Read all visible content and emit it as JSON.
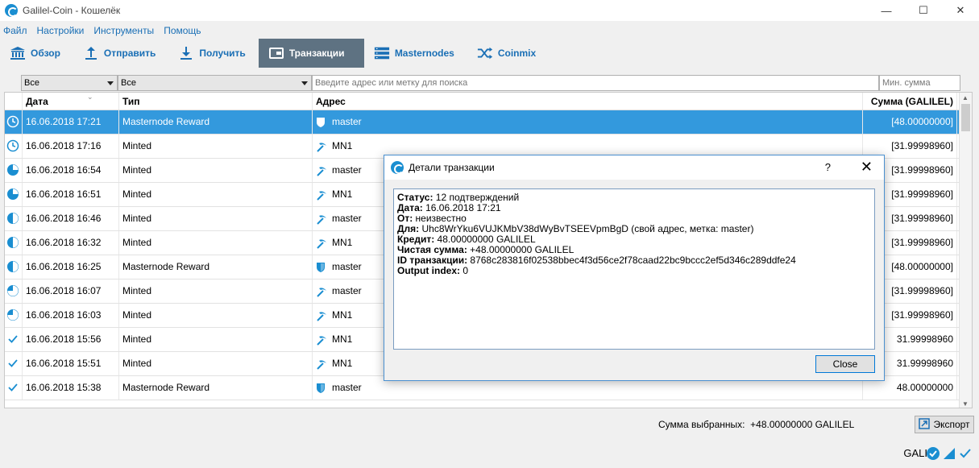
{
  "window": {
    "title": "Galilel-Coin - Кошелёк",
    "controls": [
      "—",
      "☐",
      "✕"
    ]
  },
  "menu": [
    "Файл",
    "Настройки",
    "Инструменты",
    "Помощь"
  ],
  "toolbar": [
    {
      "label": "Обзор",
      "icon": "bank-icon"
    },
    {
      "label": "Отправить",
      "icon": "upload-icon"
    },
    {
      "label": "Получить",
      "icon": "download-icon"
    },
    {
      "label": "Транзакции",
      "icon": "wallet-icon"
    },
    {
      "label": "Masternodes",
      "icon": "servers-icon"
    },
    {
      "label": "Coinmix",
      "icon": "shuffle-icon"
    }
  ],
  "filters": {
    "date": "Все",
    "type": "Все",
    "search_placeholder": "Введите адрес или метку для поиска",
    "min_amount_placeholder": "Мин. сумма"
  },
  "columns": [
    "Дата",
    "Тип",
    "Адрес",
    "Сумма (GALILEL)"
  ],
  "rows": [
    {
      "status": "clock",
      "date": "16.06.2018 17:21",
      "type": "Masternode Reward",
      "addr_icon": "shield",
      "address": "master",
      "amount": "[48.00000000]",
      "selected": true
    },
    {
      "status": "clock",
      "date": "16.06.2018 17:16",
      "type": "Minted",
      "addr_icon": "pickaxe",
      "address": "MN1",
      "amount": "[31.99998960]"
    },
    {
      "status": "pie-1",
      "date": "16.06.2018 16:54",
      "type": "Minted",
      "addr_icon": "pickaxe",
      "address": "master",
      "amount": "[31.99998960]"
    },
    {
      "status": "pie-1",
      "date": "16.06.2018 16:51",
      "type": "Minted",
      "addr_icon": "pickaxe",
      "address": "MN1",
      "amount": "[31.99998960]"
    },
    {
      "status": "pie-2",
      "date": "16.06.2018 16:46",
      "type": "Minted",
      "addr_icon": "pickaxe",
      "address": "master",
      "amount": "[31.99998960]"
    },
    {
      "status": "pie-2",
      "date": "16.06.2018 16:32",
      "type": "Minted",
      "addr_icon": "pickaxe",
      "address": "MN1",
      "amount": "[31.99998960]"
    },
    {
      "status": "pie-2",
      "date": "16.06.2018 16:25",
      "type": "Masternode Reward",
      "addr_icon": "shield",
      "address": "master",
      "amount": "[48.00000000]"
    },
    {
      "status": "pie-3",
      "date": "16.06.2018 16:07",
      "type": "Minted",
      "addr_icon": "pickaxe",
      "address": "master",
      "amount": "[31.99998960]"
    },
    {
      "status": "pie-3",
      "date": "16.06.2018 16:03",
      "type": "Minted",
      "addr_icon": "pickaxe",
      "address": "MN1",
      "amount": "[31.99998960]"
    },
    {
      "status": "check",
      "date": "16.06.2018 15:56",
      "type": "Minted",
      "addr_icon": "pickaxe",
      "address": "MN1",
      "amount": "31.99998960"
    },
    {
      "status": "check",
      "date": "16.06.2018 15:51",
      "type": "Minted",
      "addr_icon": "pickaxe",
      "address": "MN1",
      "amount": "31.99998960"
    },
    {
      "status": "check",
      "date": "16.06.2018 15:38",
      "type": "Masternode Reward",
      "addr_icon": "shield",
      "address": "master",
      "amount": "48.00000000"
    }
  ],
  "footer": {
    "sum_label": "Сумма выбранных:",
    "sum_value": "+48.00000000 GALILEL",
    "export": "Экспорт"
  },
  "status_bar": {
    "unit": "GALI"
  },
  "dialog": {
    "title": "Детали транзакции",
    "help": "?",
    "close_x": "✕",
    "lines": [
      {
        "label": "Статус:",
        "value": " 12 подтверждений"
      },
      {
        "label": "Дата:",
        "value": " 16.06.2018 17:21"
      },
      {
        "label": "От:",
        "value": " неизвестно"
      },
      {
        "label": "Для:",
        "value": " Uhc8WrYku6VUJKMbV38dWyBvTSEEVpmBgD (свой адрес, метка: master)"
      },
      {
        "label": "Кредит:",
        "value": " 48.00000000 GALILEL"
      },
      {
        "label": "Чистая сумма:",
        "value": " +48.00000000 GALILEL"
      },
      {
        "label": "ID транзакции:",
        "value": " 8768c283816f02538bbec4f3d56ce2f78caad22bc9bccc2ef5d346c289ddfe24"
      },
      {
        "label": "Output index:",
        "value": " 0"
      }
    ],
    "close_button": "Close"
  },
  "colors": {
    "accent": "#1a6fb5",
    "selection": "#3399dd",
    "active_tab": "#5e7282"
  }
}
